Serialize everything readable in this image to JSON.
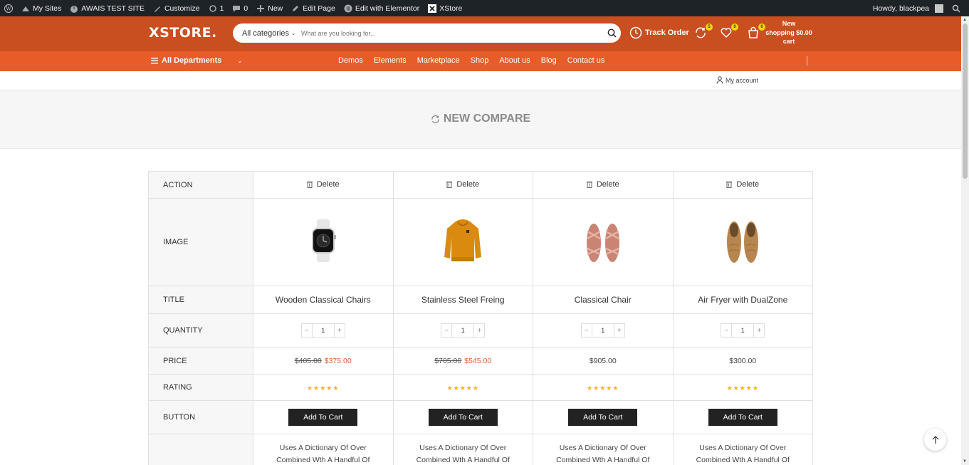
{
  "adminbar": {
    "my_sites": "My Sites",
    "site_name": "AWAIS TEST SITE",
    "customize": "Customize",
    "updates_count": "1",
    "comments_count": "0",
    "new": "New",
    "edit_page": "Edit Page",
    "edit_elementor": "Edit with Elementor",
    "xstore": "XStore",
    "howdy": "Howdy, blackpea"
  },
  "header": {
    "logo": "XSTORE.",
    "search_category": "All categories",
    "search_placeholder": "What are you looking for...",
    "track_order": "Track Order",
    "compare_count": "5",
    "wishlist_count": "0",
    "cart_count": "0",
    "cart_line1": "New",
    "cart_line2": "shopping $0.00",
    "cart_line3": "cart",
    "accent_color": "#e85c2a",
    "header_color": "#c94f20"
  },
  "nav": {
    "departments": "All Departments",
    "items": [
      "Demos",
      "Elements",
      "Marketplace",
      "Shop",
      "About us",
      "Blog",
      "Contact us"
    ]
  },
  "account": {
    "label": "My account"
  },
  "page": {
    "title": "NEW COMPARE"
  },
  "compare": {
    "labels": {
      "action": "ACTION",
      "image": "IMAGE",
      "title": "TITLE",
      "quantity": "QUANTITY",
      "price": "PRICE",
      "rating": "RATING",
      "button": "BUTTON"
    },
    "delete_label": "Delete",
    "button_label": "Add To Cart",
    "rating_stars": "★★★★★",
    "products": [
      {
        "title": "Wooden Classical Chairs",
        "qty": "1",
        "old_price": "$405.00",
        "price": "$375.00",
        "image": "smartwatch",
        "desc1": "Uses A Dictionary Of Over",
        "desc2": "Combined Wth A Handful Of"
      },
      {
        "title": "Stainless Steel Freing",
        "qty": "1",
        "old_price": "$705.00",
        "price": "$545.00",
        "image": "orange-hoodie",
        "desc1": "Uses A Dictionary Of Over",
        "desc2": "Combined Wth A Handful Of"
      },
      {
        "title": "Classical Chair",
        "qty": "1",
        "old_price": "",
        "price": "$905.00",
        "image": "pink-sandals",
        "desc1": "Uses A Dictionary Of Over",
        "desc2": "Combined Wth A Handful Of"
      },
      {
        "title": "Air Fryer with DualZone",
        "qty": "1",
        "old_price": "",
        "price": "$300.00",
        "image": "tan-loafers",
        "desc1": "Uses A Dictionary Of Over",
        "desc2": "Combined Wth A Handful Of"
      }
    ]
  }
}
